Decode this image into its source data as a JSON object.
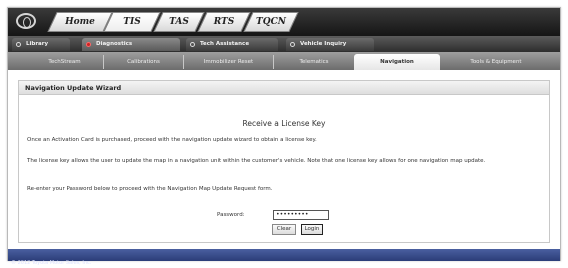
{
  "top_tabs": [
    "Home",
    "TIS",
    "TAS",
    "RTS",
    "TQCN"
  ],
  "sub_tabs": [
    "Library",
    "Diagnostics",
    "Tech Assistance",
    "Vehicle Inquiry"
  ],
  "nav_tabs": [
    "TechStream",
    "Calibrations",
    "Immobilizer Reset",
    "Telematics",
    "Navigation",
    "Tools & Equipment"
  ],
  "panel": {
    "header": "Navigation Update Wizard",
    "title": "Receive a License Key",
    "para1": "Once an Activation Card is purchased, proceed with the navigation update wizard to obtain a license key.",
    "para2": "The license key allows the user to update the map in a navigation unit within the customer's vehicle. Note that one license key allows for one navigation map update.",
    "para3": "Re-enter your Password below to proceed with the Navigation Map Update Request form."
  },
  "form": {
    "password_label": "Password:",
    "password_value": "•••••••••",
    "clear_label": "Clear",
    "login_label": "Login"
  },
  "footer": "© 2012 Toyota Motor Sales, Inc.",
  "colors": {
    "footer": "#2b3d78",
    "active_dot": "#cc2222"
  }
}
